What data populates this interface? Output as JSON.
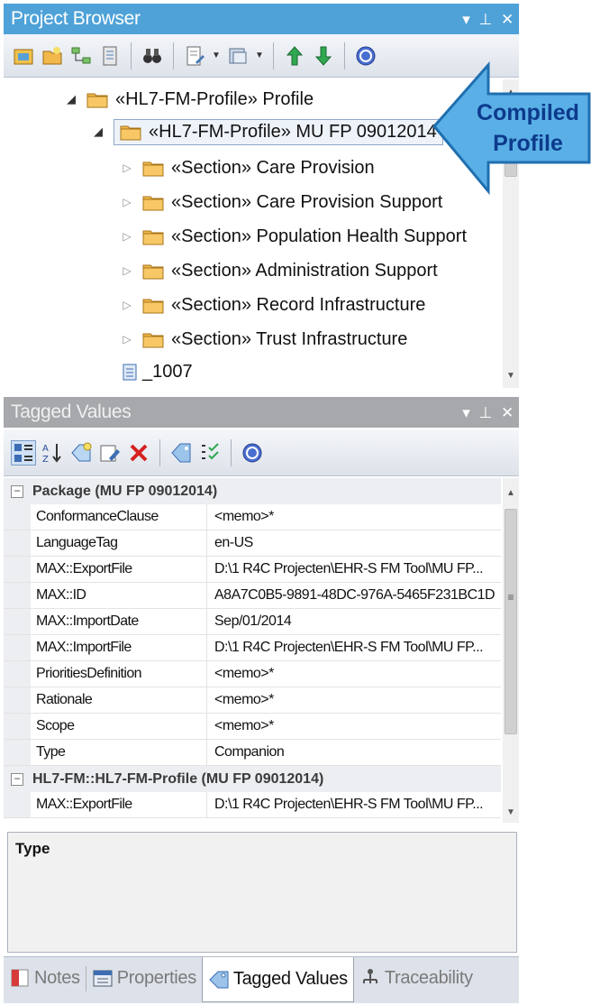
{
  "project_browser": {
    "title": "Project Browser",
    "controls": [
      "▾",
      "⊥",
      "✕"
    ]
  },
  "tree": {
    "items": [
      {
        "label": "«HL7-FM-Profile» Profile",
        "expanded": true
      },
      {
        "label": "«HL7-FM-Profile» MU FP 09012014",
        "expanded": true,
        "selected": true
      },
      {
        "label": "«Section» Care Provision"
      },
      {
        "label": "«Section» Care Provision Support"
      },
      {
        "label": "«Section» Population Health Support"
      },
      {
        "label": "«Section» Administration Support"
      },
      {
        "label": "«Section» Record Infrastructure"
      },
      {
        "label": "«Section» Trust Infrastructure"
      },
      {
        "label": "_1007"
      }
    ]
  },
  "callout": {
    "line1": "Compiled",
    "line2": "Profile"
  },
  "tagged_values_panel": {
    "title": "Tagged Values",
    "controls": [
      "▾",
      "⊥",
      "✕"
    ]
  },
  "grid": {
    "group1": "Package (MU FP 09012014)",
    "rows1": [
      {
        "name": "ConformanceClause",
        "value": "<memo>*"
      },
      {
        "name": "LanguageTag",
        "value": "en-US"
      },
      {
        "name": "MAX::ExportFile",
        "value": "D:\\1 R4C Projecten\\EHR-S FM Tool\\MU FP..."
      },
      {
        "name": "MAX::ID",
        "value": "A8A7C0B5-9891-48DC-976A-5465F231BC1D"
      },
      {
        "name": "MAX::ImportDate",
        "value": "Sep/01/2014"
      },
      {
        "name": "MAX::ImportFile",
        "value": "D:\\1 R4C Projecten\\EHR-S FM Tool\\MU FP..."
      },
      {
        "name": "PrioritiesDefinition",
        "value": "<memo>*"
      },
      {
        "name": "Rationale",
        "value": "<memo>*"
      },
      {
        "name": "Scope",
        "value": "<memo>*"
      },
      {
        "name": "Type",
        "value": "Companion"
      }
    ],
    "group2": "HL7-FM::HL7-FM-Profile (MU FP 09012014)",
    "rows2": [
      {
        "name": "MAX::ExportFile",
        "value": "D:\\1 R4C Projecten\\EHR-S FM Tool\\MU FP..."
      }
    ]
  },
  "description": {
    "title": "Type"
  },
  "tabs": [
    {
      "label": "Notes",
      "icon": "notes-icon"
    },
    {
      "label": "Properties",
      "icon": "properties-icon"
    },
    {
      "label": "Tagged Values",
      "icon": "tag-icon",
      "active": true
    },
    {
      "label": "Traceability",
      "icon": "traceability-icon"
    }
  ],
  "colors": {
    "title_active": "#4ea2d8",
    "title_inactive": "#a6a8ab",
    "callout_fill": "#5ab0e6",
    "callout_text": "#0d3a8c",
    "folder": "#f2b84b"
  }
}
